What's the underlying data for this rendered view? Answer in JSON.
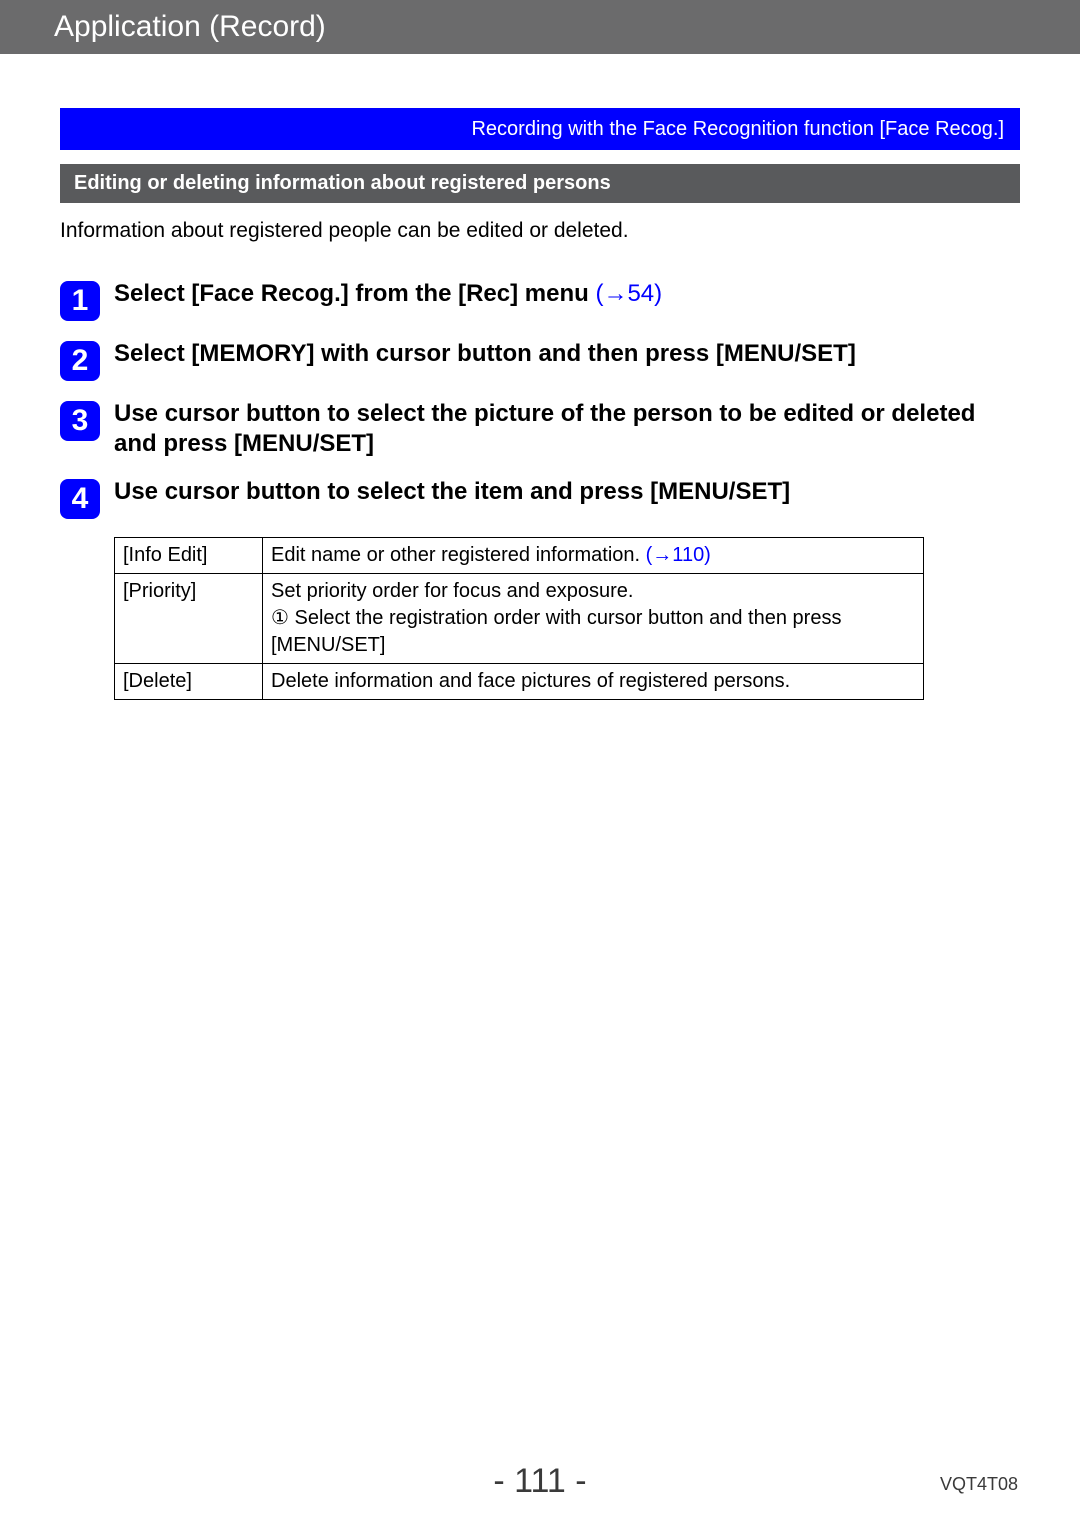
{
  "header": {
    "title": "Application (Record)"
  },
  "blue_banner": "Recording with the Face Recognition function  [Face Recog.]",
  "subheader": "Editing or deleting information about registered persons",
  "intro": "Information about registered people can be edited or deleted.",
  "steps": [
    {
      "num": "1",
      "text": "Select [Face Recog.] from the [Rec] menu ",
      "link": "(→54)"
    },
    {
      "num": "2",
      "text": "Select [MEMORY] with cursor button and then press [MENU/SET]",
      "link": ""
    },
    {
      "num": "3",
      "text": "Use cursor button to select the picture of the person to be edited or deleted and press [MENU/SET]",
      "link": ""
    },
    {
      "num": "4",
      "text": "Use cursor button to select the item and press [MENU/SET]",
      "link": ""
    }
  ],
  "table": {
    "rows": [
      {
        "name": "[Info Edit]",
        "desc_pre": "Edit name or other registered information. ",
        "desc_link": "(→110)",
        "desc_post": ""
      },
      {
        "name": "[Priority]",
        "desc_pre": "Set priority order for focus and exposure.\n① Select the registration order with cursor button and then press [MENU/SET]",
        "desc_link": "",
        "desc_post": ""
      },
      {
        "name": "[Delete]",
        "desc_pre": "Delete information and face pictures of registered persons.",
        "desc_link": "",
        "desc_post": ""
      }
    ]
  },
  "footer": {
    "page": "- 111 -",
    "code": "VQT4T08"
  }
}
